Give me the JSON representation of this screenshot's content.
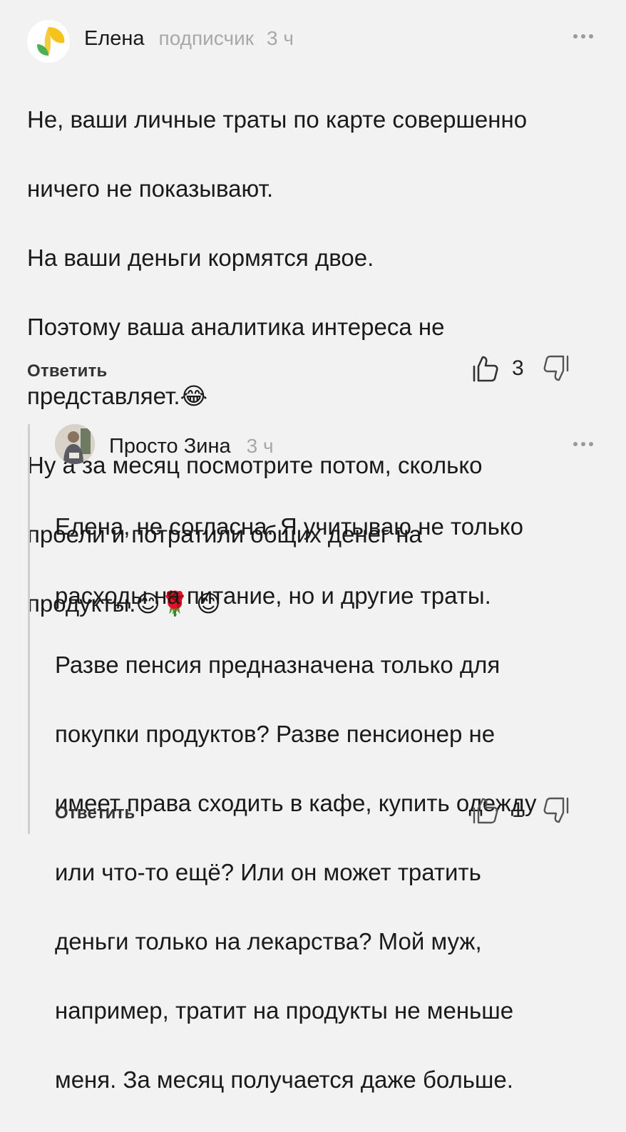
{
  "comment1": {
    "author": "Елена",
    "badge": "подписчик",
    "time": "3 ч",
    "text_lines": [
      "Не, ваши личные траты по карте совершенно",
      "ничего не показывают.",
      "На ваши деньги кормятся двое.",
      "Поэтому ваша аналитика интереса не",
      "представляет.",
      "Ну а за месяц посмотрите потом, сколько",
      "проели и потратили общих денег на",
      "продукты."
    ],
    "emoji_after_line5": "😂",
    "emoji_after_line8": "😊🌹 😊",
    "reply_label": "Ответить",
    "likes": "3"
  },
  "comment2": {
    "author": "Просто Зина",
    "time": "3 ч",
    "text_lines": [
      "Елена, не согласна. Я учитываю не только",
      "расходы на питание, но и другие траты.",
      "Разве пенсия предназначена только для",
      "покупки продуктов? Разве пенсионер не",
      "имеет права сходить в кафе, купить одежду",
      "или что-то ещё? Или он может тратить",
      "деньги только на лекарства? Мой муж,",
      "например, тратит на продукты не меньше",
      "меня. За месяц  получается даже  больше."
    ],
    "reply_label": "Ответить",
    "likes": "1"
  },
  "icons": {
    "like": "thumbs-up-icon",
    "dislike": "thumbs-down-icon",
    "more": "more-dots-icon"
  },
  "colors": {
    "background": "#f2f2f2",
    "avatar_green": "#4caf50",
    "avatar_yellow": "#f6c21c",
    "muted": "#a8a8a8"
  }
}
